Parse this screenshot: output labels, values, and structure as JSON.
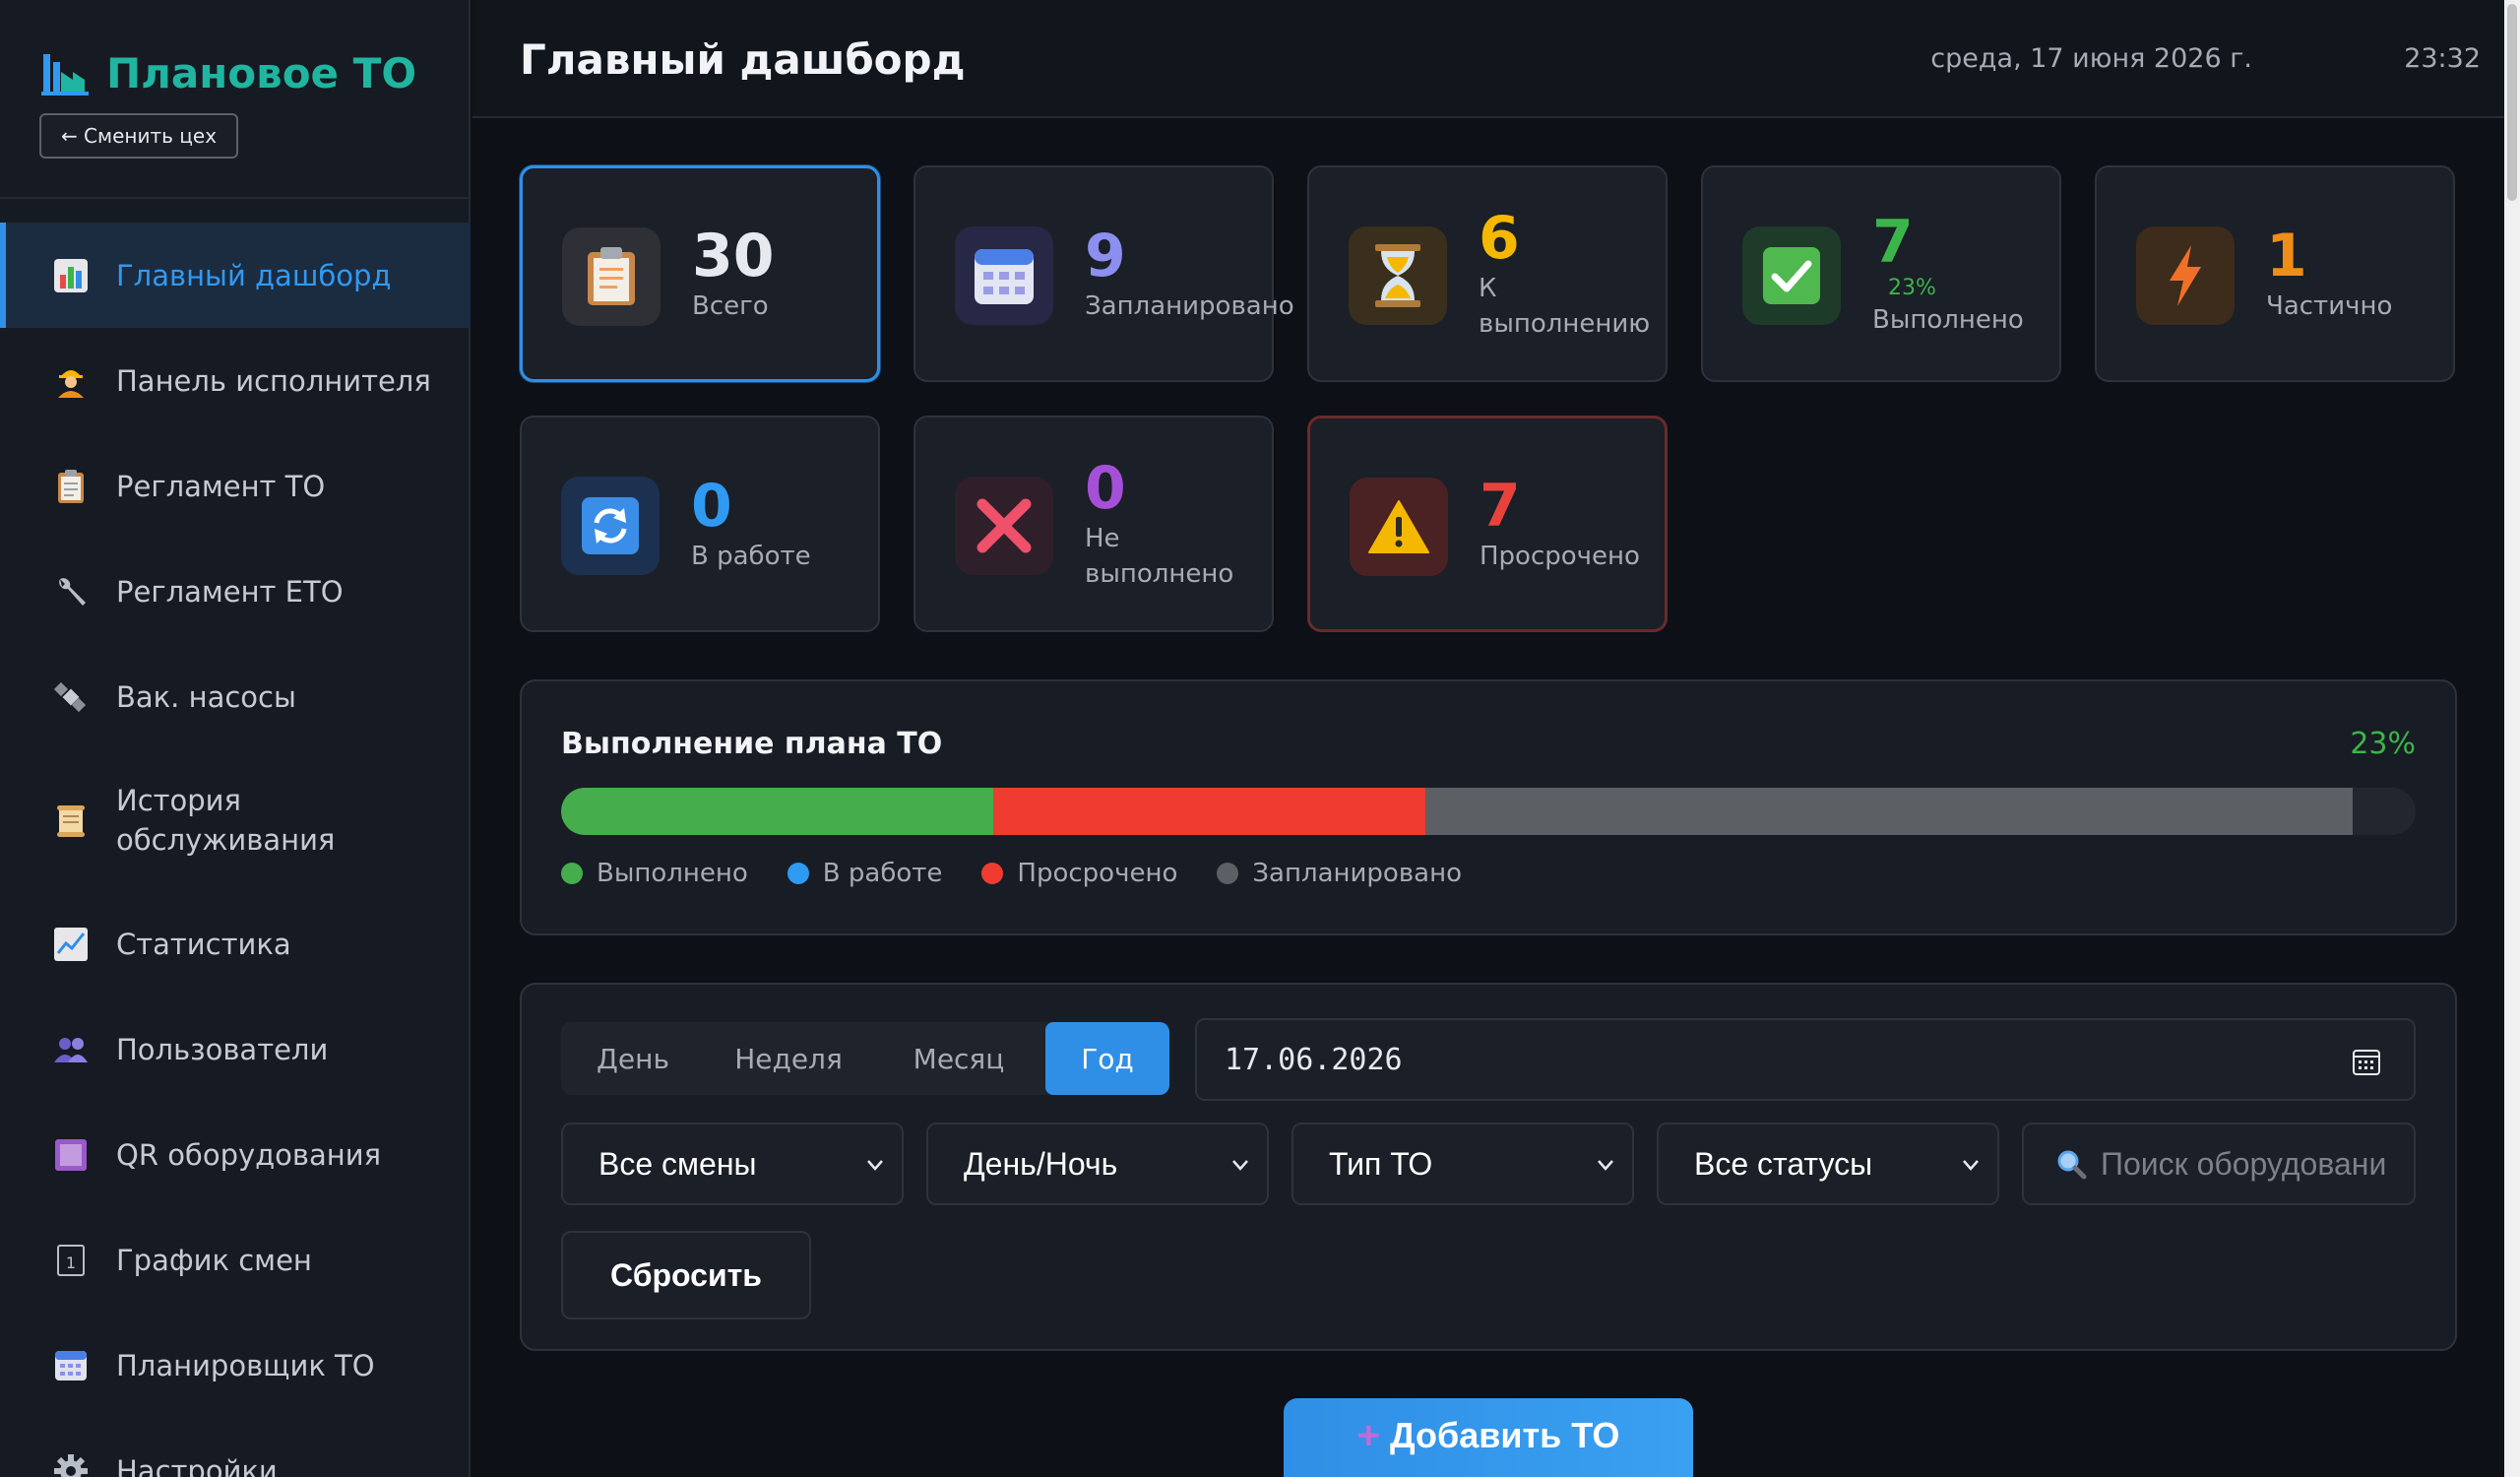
{
  "sidebar": {
    "brand": "Плановое ТО",
    "switch_button": "← Сменить цех",
    "items": [
      {
        "label": "Главный дашборд",
        "icon": "bar-chart-icon",
        "active": true
      },
      {
        "label": "Панель исполнителя",
        "icon": "worker-icon"
      },
      {
        "label": "Регламент ТО",
        "icon": "clipboard-icon"
      },
      {
        "label": "Регламент ЕТО",
        "icon": "wrench-icon"
      },
      {
        "label": "Вак. насосы",
        "icon": "satellite-icon"
      },
      {
        "label": "История обслуживания",
        "icon": "scroll-icon"
      },
      {
        "label": "Статистика",
        "icon": "trend-chart-icon"
      },
      {
        "label": "Пользователи",
        "icon": "users-icon"
      },
      {
        "label": "QR оборудования",
        "icon": "qr-square-icon"
      },
      {
        "label": "График смен",
        "icon": "calendar-1-icon"
      },
      {
        "label": "Планировщик ТО",
        "icon": "calendar-grid-icon"
      },
      {
        "label": "Настройки",
        "icon": "gear-icon"
      }
    ]
  },
  "header": {
    "title": "Главный дашборд",
    "date": "среда, 17 июня 2026 г.",
    "time": "23:32"
  },
  "stats": [
    {
      "value": "30",
      "label": "Всего",
      "icon": "clipboard-icon",
      "color": "#ffffff"
    },
    {
      "value": "9",
      "label": "Запланировано",
      "icon": "calendar-icon",
      "color": "#8c8ff0"
    },
    {
      "value": "6",
      "label": "К выполнению",
      "icon": "hourglass-icon",
      "color": "#f5b800"
    },
    {
      "value": "7",
      "sub": "23%",
      "label": "Выполнено",
      "icon": "check-icon",
      "color": "#3bb54a"
    },
    {
      "value": "1",
      "label": "Частично",
      "icon": "lightning-icon",
      "color": "#f08c1a"
    },
    {
      "value": "0",
      "label": "В работе",
      "icon": "refresh-icon",
      "color": "#2f9af2"
    },
    {
      "value": "0",
      "label": "Не выполнено",
      "icon": "cross-icon",
      "color": "#a64fd8"
    },
    {
      "value": "7",
      "label": "Просрочено",
      "icon": "warning-icon",
      "color": "#e8423b"
    }
  ],
  "progress": {
    "title": "Выполнение плана ТО",
    "percent": "23%",
    "segments": [
      {
        "name": "Выполнено",
        "fraction": 0.233,
        "color": "#46ad4c"
      },
      {
        "name": "В работе",
        "fraction": 0.0,
        "color": "#2f9af2"
      },
      {
        "name": "Просрочено",
        "fraction": 0.233,
        "color": "#f03c30"
      },
      {
        "name": "Запланировано",
        "fraction": 0.5,
        "color": "#5c6064"
      }
    ],
    "legend": [
      "Выполнено",
      "В работе",
      "Просрочено",
      "Запланировано"
    ]
  },
  "filters": {
    "tabs": [
      "День",
      "Неделя",
      "Месяц",
      "Год"
    ],
    "active_tab": "Год",
    "date": "17.06.2026",
    "shift": "Все смены",
    "daynight": "День/Ночь",
    "type": "Тип ТО",
    "status": "Все статусы",
    "search_placeholder": "Поиск оборудовани",
    "reset": "Сбросить"
  },
  "add_button": "Добавить ТО",
  "colors": {
    "accent": "#2f8fe6",
    "brand": "#1fb5a0",
    "success": "#3bb54a",
    "danger": "#e8423b"
  }
}
